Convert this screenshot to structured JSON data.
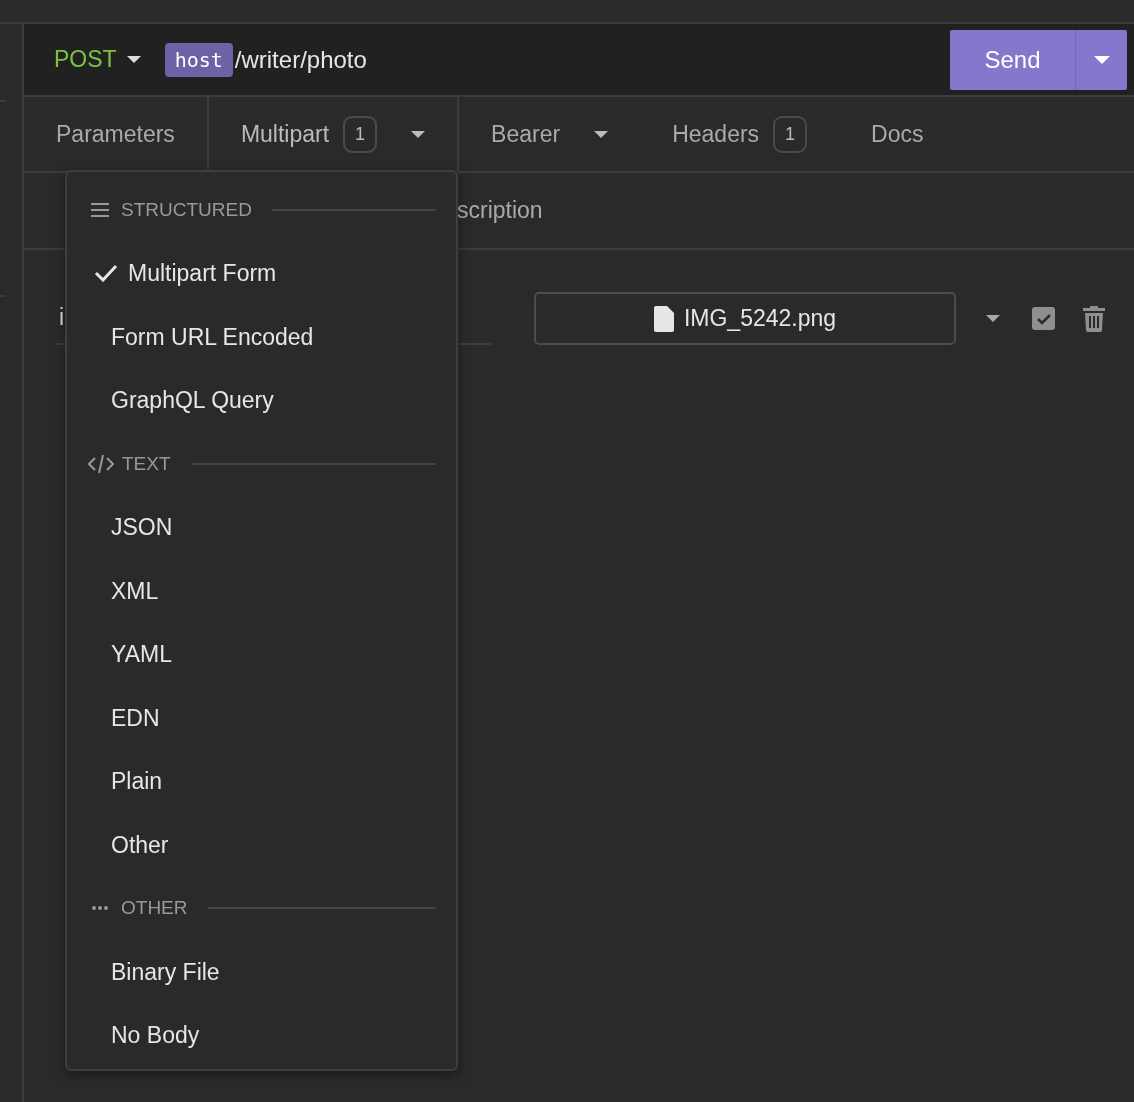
{
  "request": {
    "method": "POST",
    "host": "host",
    "path": "/writer/photo"
  },
  "send_button": "Send",
  "tabs": [
    {
      "label": "Parameters",
      "selected": false
    },
    {
      "label": "Multipart",
      "count": "1",
      "dropdown": true,
      "selected": true
    },
    {
      "label": "Bearer",
      "dropdown": true,
      "selected": false
    },
    {
      "label": "Headers",
      "count": "1",
      "selected": false
    },
    {
      "label": "Docs",
      "selected": false
    }
  ],
  "subtabs": [
    "scription"
  ],
  "parameter": {
    "name": "i",
    "file": "IMG_5242.png",
    "enabled": true
  },
  "body_menu": {
    "sections": [
      {
        "kind": "structured",
        "label": "STRUCTURED",
        "items": [
          {
            "label": "Multipart Form",
            "selected": true
          },
          {
            "label": "Form URL Encoded",
            "selected": false
          },
          {
            "label": "GraphQL Query",
            "selected": false
          }
        ]
      },
      {
        "kind": "text",
        "label": "TEXT",
        "items": [
          {
            "label": "JSON",
            "selected": false
          },
          {
            "label": "XML",
            "selected": false
          },
          {
            "label": "YAML",
            "selected": false
          },
          {
            "label": "EDN",
            "selected": false
          },
          {
            "label": "Plain",
            "selected": false
          },
          {
            "label": "Other",
            "selected": false
          }
        ]
      },
      {
        "kind": "other",
        "label": "OTHER",
        "items": [
          {
            "label": "Binary File",
            "selected": false
          },
          {
            "label": "No Body",
            "selected": false
          }
        ]
      }
    ]
  }
}
